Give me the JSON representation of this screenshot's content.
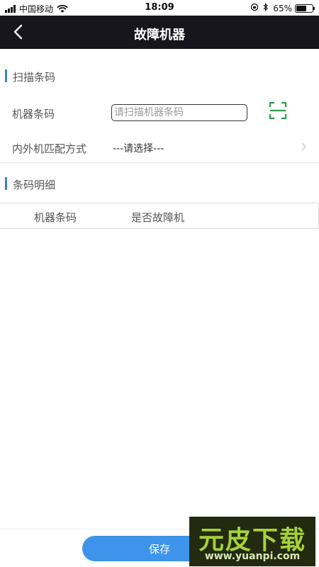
{
  "status_bar": {
    "carrier": "中国移动",
    "time": "18:09",
    "battery": "65%",
    "battery_level": 0.65
  },
  "nav": {
    "title": "故障机器"
  },
  "scan_section": {
    "title": "扫描条码",
    "barcode_label": "机器条码",
    "barcode_placeholder": "请扫描机器条码",
    "barcode_value": "",
    "match_label": "内外机匹配方式",
    "match_value": "---请选择---"
  },
  "detail_section": {
    "title": "条码明细",
    "columns": [
      "机器条码",
      "是否故障机"
    ]
  },
  "footer": {
    "save_label": "保存"
  },
  "watermark": {
    "brand": "元皮下载",
    "url": "www.yuanpi.com"
  },
  "colors": {
    "nav_bg": "#16161c",
    "accent_bar": "#3b82c4",
    "scan_icon": "#2e9b4f",
    "save_button": "#3d94ea"
  }
}
